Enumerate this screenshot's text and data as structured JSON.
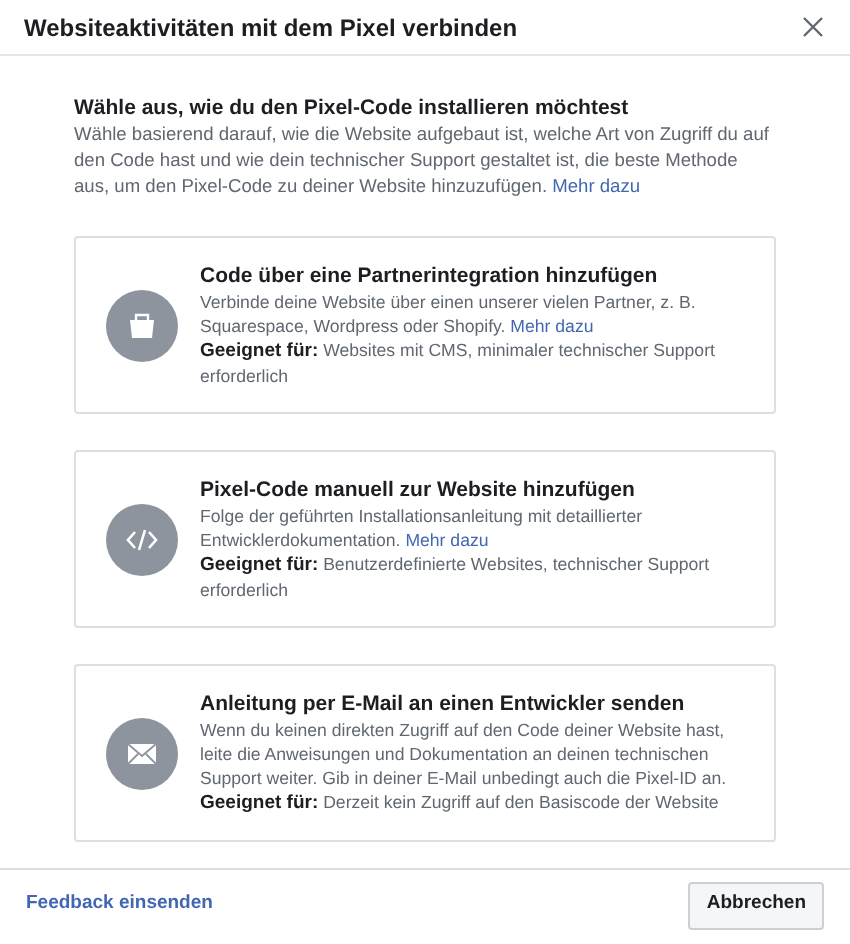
{
  "window": {
    "title": "Websiteaktivitäten mit dem Pixel verbinden"
  },
  "intro": {
    "heading": "Wähle aus, wie du den Pixel-Code installieren möchtest",
    "text": "Wähle basierend darauf, wie die Website aufgebaut ist, welche Art von Zugriff du auf den Code hast und wie dein technischer Support gestaltet ist, die beste Methode aus, um den Pixel-Code zu deiner Website hinzuzufügen.",
    "link": "Mehr dazu"
  },
  "options": [
    {
      "title": "Code über eine Partnerintegration hinzufügen",
      "text": "Verbinde deine Website über einen unserer vielen Partner, z. B. Squarespace, Wordpress oder Shopify.",
      "link": "Mehr dazu",
      "suitable": "**Geeignet für:** Websites mit CMS, minimaler technischer Support erforderlich"
    },
    {
      "title": "Pixel-Code manuell zur Website hinzufügen",
      "text": "Folge der geführten Installationsanleitung mit detaillierter Entwicklerdokumentation.",
      "link": "Mehr dazu",
      "suitable": "**Geeignet für:** Benutzerdefinierte Websites, technischer Support erforderlich"
    },
    {
      "title": "Anleitung per E-Mail an einen Entwickler senden",
      "text": "Wenn du keinen direkten Zugriff auf den Code deiner Website hast, leite die Anweisungen und Dokumentation an deinen technischen Support weiter. Gib in deiner E-Mail unbedingt auch die Pixel-ID an.",
      "suitable": "**Geeignet für:** Derzeit kein Zugriff auf den Basiscode der Website"
    }
  ],
  "footer": {
    "feedback_link": "Feedback einsenden",
    "cancel_button": "Abbrechen"
  }
}
